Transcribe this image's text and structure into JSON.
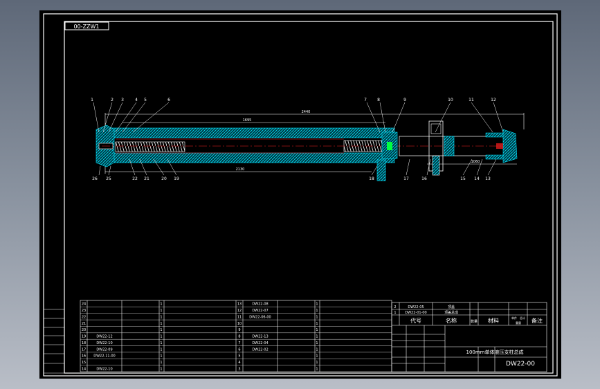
{
  "drawing": {
    "drawing_code": "00-ZZW1",
    "title": "100mm单体液压支柱总成",
    "drawing_number": "DW22-00",
    "balloons": [
      "1",
      "2",
      "3",
      "4",
      "5",
      "6",
      "7",
      "8",
      "9",
      "10",
      "11",
      "12",
      "26",
      "25",
      "22",
      "21",
      "20",
      "19",
      "18",
      "17",
      "16",
      "15",
      "14",
      "13"
    ],
    "dimensions": {
      "overall": "2440",
      "top_inner": "1695",
      "bottom": "2130",
      "right_lower": "1060"
    }
  },
  "title_block": {
    "headers": {
      "code": "代号",
      "name": "名称",
      "qty": "数量",
      "material": "材料",
      "weight_single": "单件",
      "weight_total": "总计",
      "weight_label": "重量",
      "remark": "备注"
    },
    "top_rows": [
      {
        "seq": "2",
        "code": "DW22-05",
        "name": "顶盖"
      },
      {
        "seq": "1",
        "code": "DW22-01-00",
        "name": "顶盖总成"
      }
    ]
  },
  "bom": {
    "left": [
      {
        "seq": "24",
        "code": "",
        "name": "",
        "qty": "1"
      },
      {
        "seq": "23",
        "code": "",
        "name": "",
        "qty": "1"
      },
      {
        "seq": "22",
        "code": "",
        "name": "",
        "qty": "1"
      },
      {
        "seq": "21",
        "code": "",
        "name": "",
        "qty": "1"
      },
      {
        "seq": "20",
        "code": "",
        "name": "",
        "qty": "1"
      },
      {
        "seq": "19",
        "code": "DW22-12",
        "name": "",
        "qty": "1"
      },
      {
        "seq": "18",
        "code": "DW22-10",
        "name": "",
        "qty": "1"
      },
      {
        "seq": "17",
        "code": "DW22-09",
        "name": "",
        "qty": "1"
      },
      {
        "seq": "16",
        "code": "DW22-11-00",
        "name": "",
        "qty": "1"
      },
      {
        "seq": "15",
        "code": "",
        "name": "",
        "qty": "1"
      },
      {
        "seq": "14",
        "code": "DW22-10",
        "name": "",
        "qty": "1"
      }
    ],
    "right": [
      {
        "seq": "13",
        "code": "DW22-08",
        "name": "",
        "qty": "1"
      },
      {
        "seq": "12",
        "code": "DW22-07",
        "name": "",
        "qty": "1"
      },
      {
        "seq": "11",
        "code": "DW22-06-00",
        "name": "",
        "qty": "1"
      },
      {
        "seq": "10",
        "code": "",
        "name": "",
        "qty": "1"
      },
      {
        "seq": "9",
        "code": "",
        "name": "",
        "qty": "1"
      },
      {
        "seq": "8",
        "code": "DW22-13",
        "name": "",
        "qty": "1"
      },
      {
        "seq": "7",
        "code": "DW22-04",
        "name": "",
        "qty": "1"
      },
      {
        "seq": "6",
        "code": "DW22-02",
        "name": "",
        "qty": "1"
      },
      {
        "seq": "5",
        "code": "",
        "name": "",
        "qty": "1"
      },
      {
        "seq": "4",
        "code": "",
        "name": "",
        "qty": "1"
      },
      {
        "seq": "3",
        "code": "",
        "name": "",
        "qty": "1"
      }
    ]
  },
  "colors": {
    "frame": "#ffffff",
    "hatch": "#00e5ff",
    "centerline": "#ff2020",
    "spring": "#ffffff",
    "part_green": "#00ff40",
    "text": "#ffffff"
  }
}
